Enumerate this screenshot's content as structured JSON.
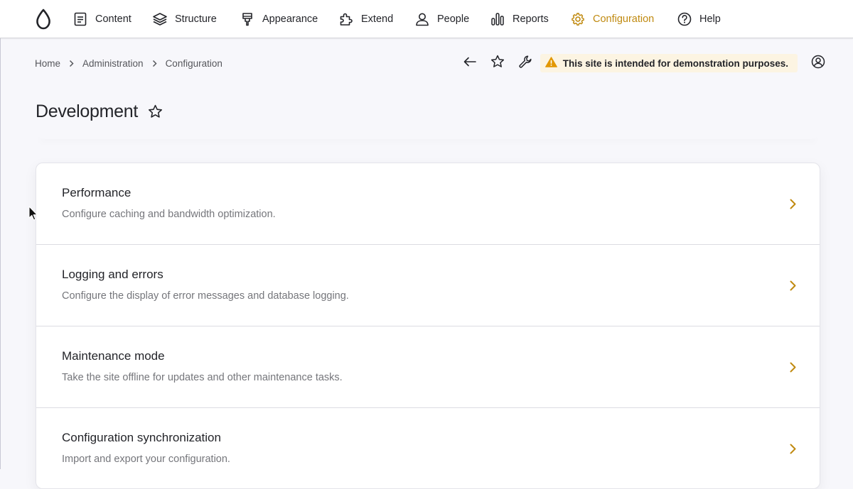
{
  "toolbar": {
    "nav": [
      {
        "label": "Content",
        "icon": "content-icon"
      },
      {
        "label": "Structure",
        "icon": "structure-icon"
      },
      {
        "label": "Appearance",
        "icon": "appearance-icon"
      },
      {
        "label": "Extend",
        "icon": "extend-icon"
      },
      {
        "label": "People",
        "icon": "people-icon"
      },
      {
        "label": "Reports",
        "icon": "reports-icon"
      },
      {
        "label": "Configuration",
        "icon": "configuration-icon",
        "active": true
      },
      {
        "label": "Help",
        "icon": "help-icon"
      }
    ],
    "accent_color": "#c08a10"
  },
  "breadcrumb": {
    "items": [
      "Home",
      "Administration",
      "Configuration"
    ]
  },
  "demo_banner": {
    "text": "This site is intended for demonstration purposes.",
    "warning_color": "#e29700"
  },
  "page": {
    "title": "Development"
  },
  "items": [
    {
      "title": "Performance",
      "description": "Configure caching and bandwidth optimization."
    },
    {
      "title": "Logging and errors",
      "description": "Configure the display of error messages and database logging."
    },
    {
      "title": "Maintenance mode",
      "description": "Take the site offline for updates and other maintenance tasks."
    },
    {
      "title": "Configuration synchronization",
      "description": "Import and export your configuration."
    }
  ]
}
